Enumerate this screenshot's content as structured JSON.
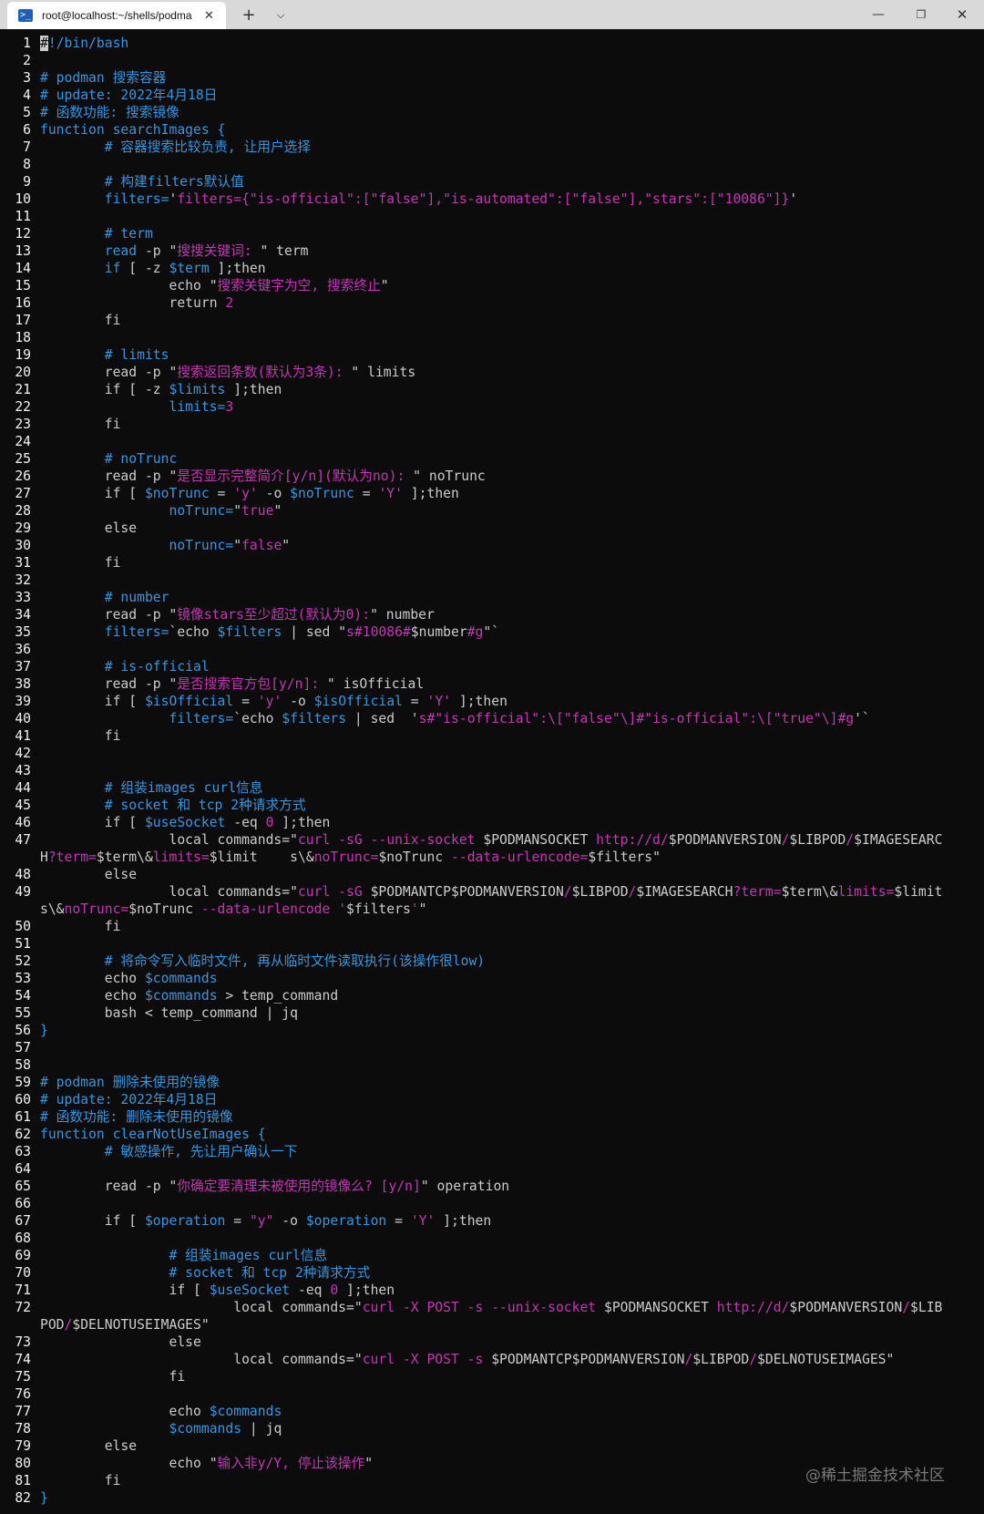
{
  "tab": {
    "title": "root@localhost:~/shells/podma",
    "icon": "powershell-icon"
  },
  "window_controls": {
    "new_tab": "+",
    "dropdown": "⌵",
    "minimize": "—",
    "maximize": "❐",
    "close": "✕"
  },
  "watermark": "@稀土掘金技术社区",
  "colors": {
    "comment": "#3a96dd",
    "string": "#c239b3",
    "text": "#cccccc",
    "background": "#0c0c0c"
  },
  "lines": [
    {
      "n": "1",
      "segs": [
        [
          "cursor",
          "#"
        ],
        [
          "c",
          "!/bin/bash"
        ]
      ]
    },
    {
      "n": "2",
      "segs": []
    },
    {
      "n": "3",
      "segs": [
        [
          "c",
          "# podman 搜索容器"
        ]
      ]
    },
    {
      "n": "4",
      "segs": [
        [
          "c",
          "# update: 2022年4月18日"
        ]
      ]
    },
    {
      "n": "5",
      "segs": [
        [
          "c",
          "# 函数功能: 搜索镜像"
        ]
      ]
    },
    {
      "n": "6",
      "segs": [
        [
          "c",
          "function searchImages {"
        ]
      ]
    },
    {
      "n": "7",
      "segs": [
        [
          "c",
          "        # 容器搜索比较负责, 让用户选择"
        ]
      ]
    },
    {
      "n": "8",
      "segs": []
    },
    {
      "n": "9",
      "segs": [
        [
          "c",
          "        # 构建filters默认值"
        ]
      ]
    },
    {
      "n": "10",
      "segs": [
        [
          "c",
          "        filters="
        ],
        [
          "w",
          "'"
        ],
        [
          "s",
          "filters={\"is-official\":[\"false\"],\"is-automated\":[\"false\"],\"stars\":[\"10086\"]}"
        ],
        [
          "w",
          "'"
        ]
      ]
    },
    {
      "n": "11",
      "segs": []
    },
    {
      "n": "12",
      "segs": [
        [
          "c",
          "        # term"
        ]
      ]
    },
    {
      "n": "13",
      "segs": [
        [
          "c",
          "        read"
        ],
        [
          "w",
          " -p \""
        ],
        [
          "s",
          "搜搜关键词: "
        ],
        [
          "w",
          "\" term"
        ]
      ]
    },
    {
      "n": "14",
      "segs": [
        [
          "c",
          "        if"
        ],
        [
          "w",
          " [ -z "
        ],
        [
          "c",
          "$term"
        ],
        [
          "w",
          " ];then"
        ]
      ]
    },
    {
      "n": "15",
      "segs": [
        [
          "w",
          "                echo \""
        ],
        [
          "s",
          "搜索关键字为空, 搜索终止"
        ],
        [
          "w",
          "\""
        ]
      ]
    },
    {
      "n": "16",
      "segs": [
        [
          "w",
          "                return "
        ],
        [
          "s",
          "2"
        ]
      ]
    },
    {
      "n": "17",
      "segs": [
        [
          "w",
          "        fi"
        ]
      ]
    },
    {
      "n": "18",
      "segs": []
    },
    {
      "n": "19",
      "segs": [
        [
          "c",
          "        # limits"
        ]
      ]
    },
    {
      "n": "20",
      "segs": [
        [
          "w",
          "        read -p \""
        ],
        [
          "s",
          "搜索返回条数(默认为3条): "
        ],
        [
          "w",
          "\" limits"
        ]
      ]
    },
    {
      "n": "21",
      "segs": [
        [
          "w",
          "        if [ -z "
        ],
        [
          "c",
          "$limits"
        ],
        [
          "w",
          " ];then"
        ]
      ]
    },
    {
      "n": "22",
      "segs": [
        [
          "c",
          "                limits="
        ],
        [
          "s",
          "3"
        ]
      ]
    },
    {
      "n": "23",
      "segs": [
        [
          "w",
          "        fi"
        ]
      ]
    },
    {
      "n": "24",
      "segs": []
    },
    {
      "n": "25",
      "segs": [
        [
          "c",
          "        # noTrunc"
        ]
      ]
    },
    {
      "n": "26",
      "segs": [
        [
          "w",
          "        read -p \""
        ],
        [
          "s",
          "是否显示完整简介[y/n](默认为no): "
        ],
        [
          "w",
          "\" noTrunc"
        ]
      ]
    },
    {
      "n": "27",
      "segs": [
        [
          "w",
          "        if [ "
        ],
        [
          "c",
          "$noTrunc"
        ],
        [
          "w",
          " = "
        ],
        [
          "s",
          "'y'"
        ],
        [
          "w",
          " -o "
        ],
        [
          "c",
          "$noTrunc"
        ],
        [
          "w",
          " = "
        ],
        [
          "s",
          "'Y'"
        ],
        [
          "w",
          " ];then"
        ]
      ]
    },
    {
      "n": "28",
      "segs": [
        [
          "c",
          "                noTrunc="
        ],
        [
          "w",
          "\""
        ],
        [
          "s",
          "true"
        ],
        [
          "w",
          "\""
        ]
      ]
    },
    {
      "n": "29",
      "segs": [
        [
          "w",
          "        else"
        ]
      ]
    },
    {
      "n": "30",
      "segs": [
        [
          "c",
          "                noTrunc="
        ],
        [
          "w",
          "\""
        ],
        [
          "s",
          "false"
        ],
        [
          "w",
          "\""
        ]
      ]
    },
    {
      "n": "31",
      "segs": [
        [
          "w",
          "        fi"
        ]
      ]
    },
    {
      "n": "32",
      "segs": []
    },
    {
      "n": "33",
      "segs": [
        [
          "c",
          "        # number"
        ]
      ]
    },
    {
      "n": "34",
      "segs": [
        [
          "w",
          "        read -p \""
        ],
        [
          "s",
          "镜像stars至少超过(默认为0):"
        ],
        [
          "w",
          "\" number"
        ]
      ]
    },
    {
      "n": "35",
      "segs": [
        [
          "c",
          "        filters="
        ],
        [
          "w",
          "`echo "
        ],
        [
          "c",
          "$filters"
        ],
        [
          "w",
          " | sed \""
        ],
        [
          "s",
          "s#10086#"
        ],
        [
          "w",
          "$number"
        ],
        [
          "s",
          "#g"
        ],
        [
          "w",
          "\"`"
        ]
      ]
    },
    {
      "n": "36",
      "segs": []
    },
    {
      "n": "37",
      "segs": [
        [
          "c",
          "        # is-official"
        ]
      ]
    },
    {
      "n": "38",
      "segs": [
        [
          "w",
          "        read -p \""
        ],
        [
          "s",
          "是否搜索官方包[y/n]: "
        ],
        [
          "w",
          "\" isOfficial"
        ]
      ]
    },
    {
      "n": "39",
      "segs": [
        [
          "w",
          "        if [ "
        ],
        [
          "c",
          "$isOfficial"
        ],
        [
          "w",
          " = "
        ],
        [
          "s",
          "'y'"
        ],
        [
          "w",
          " -o "
        ],
        [
          "c",
          "$isOfficial"
        ],
        [
          "w",
          " = "
        ],
        [
          "s",
          "'Y'"
        ],
        [
          "w",
          " ];then"
        ]
      ]
    },
    {
      "n": "40",
      "segs": [
        [
          "c",
          "                filters="
        ],
        [
          "w",
          "`echo "
        ],
        [
          "c",
          "$filters"
        ],
        [
          "w",
          " | sed  '"
        ],
        [
          "s",
          "s#\"is-official\":\\[\"false\"\\]#\"is-official\":\\[\"true\"\\]#g"
        ],
        [
          "w",
          "'`"
        ]
      ]
    },
    {
      "n": "41",
      "segs": [
        [
          "w",
          "        fi"
        ]
      ]
    },
    {
      "n": "42",
      "segs": []
    },
    {
      "n": "43",
      "segs": []
    },
    {
      "n": "44",
      "segs": [
        [
          "c",
          "        # 组装images curl信息"
        ]
      ]
    },
    {
      "n": "45",
      "segs": [
        [
          "c",
          "        # socket 和 tcp 2种请求方式"
        ]
      ]
    },
    {
      "n": "46",
      "segs": [
        [
          "w",
          "        if [ "
        ],
        [
          "c",
          "$useSocket"
        ],
        [
          "w",
          " -eq "
        ],
        [
          "s",
          "0"
        ],
        [
          "w",
          " ];then"
        ]
      ]
    },
    {
      "n": "47",
      "segs": [
        [
          "w",
          "                local commands=\""
        ],
        [
          "s",
          "curl -sG --unix-socket "
        ],
        [
          "w",
          "$PODMANSOCKET "
        ],
        [
          "s",
          "http://d/"
        ],
        [
          "w",
          "$PODMANVERSION"
        ],
        [
          "s",
          "/"
        ],
        [
          "w",
          "$LIBPOD"
        ],
        [
          "s",
          "/"
        ],
        [
          "w",
          "$IMAGESEARC"
        ]
      ]
    },
    {
      "n": "",
      "segs": [
        [
          "w",
          "H"
        ],
        [
          "s",
          "?term="
        ],
        [
          "w",
          "$term\\&"
        ],
        [
          "s",
          "limits="
        ],
        [
          "w",
          "$limit    s\\&"
        ],
        [
          "s",
          "noTrunc="
        ],
        [
          "w",
          "$noTrunc "
        ],
        [
          "s",
          "--data-urlencode="
        ],
        [
          "w",
          "$filters\""
        ]
      ]
    },
    {
      "n": "48",
      "segs": [
        [
          "w",
          "        else"
        ]
      ]
    },
    {
      "n": "49",
      "segs": [
        [
          "w",
          "                local commands=\""
        ],
        [
          "s",
          "curl -sG "
        ],
        [
          "w",
          "$PODMANTCP$PODMANVERSION"
        ],
        [
          "s",
          "/"
        ],
        [
          "w",
          "$LIBPOD"
        ],
        [
          "s",
          "/"
        ],
        [
          "w",
          "$IMAGESEARCH"
        ],
        [
          "s",
          "?term="
        ],
        [
          "w",
          "$term\\&"
        ],
        [
          "s",
          "limits="
        ],
        [
          "w",
          "$limit"
        ]
      ]
    },
    {
      "n": "",
      "segs": [
        [
          "w",
          "s\\&"
        ],
        [
          "s",
          "noTrunc="
        ],
        [
          "w",
          "$noTrunc "
        ],
        [
          "s",
          "--data-urlencode '"
        ],
        [
          "w",
          "$filters"
        ],
        [
          "s",
          "'"
        ],
        [
          "w",
          "\""
        ]
      ]
    },
    {
      "n": "50",
      "segs": [
        [
          "w",
          "        fi"
        ]
      ]
    },
    {
      "n": "51",
      "segs": []
    },
    {
      "n": "52",
      "segs": [
        [
          "c",
          "        # 将命令写入临时文件, 再从临时文件读取执行(该操作很low)"
        ]
      ]
    },
    {
      "n": "53",
      "segs": [
        [
          "w",
          "        echo "
        ],
        [
          "c",
          "$commands"
        ]
      ]
    },
    {
      "n": "54",
      "segs": [
        [
          "w",
          "        echo "
        ],
        [
          "c",
          "$commands"
        ],
        [
          "w",
          " > temp_command"
        ]
      ]
    },
    {
      "n": "55",
      "segs": [
        [
          "w",
          "        bash < temp_command | jq"
        ]
      ]
    },
    {
      "n": "56",
      "segs": [
        [
          "c",
          "}"
        ]
      ]
    },
    {
      "n": "57",
      "segs": []
    },
    {
      "n": "58",
      "segs": []
    },
    {
      "n": "59",
      "segs": [
        [
          "c",
          "# podman 删除未使用的镜像"
        ]
      ]
    },
    {
      "n": "60",
      "segs": [
        [
          "c",
          "# update: 2022年4月18日"
        ]
      ]
    },
    {
      "n": "61",
      "segs": [
        [
          "c",
          "# 函数功能: 删除未使用的镜像"
        ]
      ]
    },
    {
      "n": "62",
      "segs": [
        [
          "c",
          "function clearNotUseImages {"
        ]
      ]
    },
    {
      "n": "63",
      "segs": [
        [
          "c",
          "        # 敏感操作, 先让用户确认一下"
        ]
      ]
    },
    {
      "n": "64",
      "segs": []
    },
    {
      "n": "65",
      "segs": [
        [
          "w",
          "        read -p \""
        ],
        [
          "s",
          "你确定要清理未被使用的镜像么? [y/n]"
        ],
        [
          "w",
          "\" operation"
        ]
      ]
    },
    {
      "n": "66",
      "segs": []
    },
    {
      "n": "67",
      "segs": [
        [
          "w",
          "        if [ "
        ],
        [
          "c",
          "$operation"
        ],
        [
          "w",
          " = "
        ],
        [
          "s",
          "\"y\""
        ],
        [
          "w",
          " -o "
        ],
        [
          "c",
          "$operation"
        ],
        [
          "w",
          " = "
        ],
        [
          "s",
          "'Y'"
        ],
        [
          "w",
          " ];then"
        ]
      ]
    },
    {
      "n": "68",
      "segs": []
    },
    {
      "n": "69",
      "segs": [
        [
          "c",
          "                # 组装images curl信息"
        ]
      ]
    },
    {
      "n": "70",
      "segs": [
        [
          "c",
          "                # socket 和 tcp 2种请求方式"
        ]
      ]
    },
    {
      "n": "71",
      "segs": [
        [
          "w",
          "                if [ "
        ],
        [
          "c",
          "$useSocket"
        ],
        [
          "w",
          " -eq "
        ],
        [
          "s",
          "0"
        ],
        [
          "w",
          " ];then"
        ]
      ]
    },
    {
      "n": "72",
      "segs": [
        [
          "w",
          "                        local commands=\""
        ],
        [
          "s",
          "curl -X POST -s --unix-socket "
        ],
        [
          "w",
          "$PODMANSOCKET "
        ],
        [
          "s",
          "http://d/"
        ],
        [
          "w",
          "$PODMANVERSION"
        ],
        [
          "s",
          "/"
        ],
        [
          "w",
          "$LIB"
        ]
      ]
    },
    {
      "n": "",
      "segs": [
        [
          "w",
          "POD"
        ],
        [
          "s",
          "/"
        ],
        [
          "w",
          "$DELNOTUSEIMAGES\""
        ]
      ]
    },
    {
      "n": "73",
      "segs": [
        [
          "w",
          "                else"
        ]
      ]
    },
    {
      "n": "74",
      "segs": [
        [
          "w",
          "                        local commands=\""
        ],
        [
          "s",
          "curl -X POST -s "
        ],
        [
          "w",
          "$PODMANTCP$PODMANVERSION"
        ],
        [
          "s",
          "/"
        ],
        [
          "w",
          "$LIBPOD"
        ],
        [
          "s",
          "/"
        ],
        [
          "w",
          "$DELNOTUSEIMAGES\""
        ]
      ]
    },
    {
      "n": "75",
      "segs": [
        [
          "w",
          "                fi"
        ]
      ]
    },
    {
      "n": "76",
      "segs": []
    },
    {
      "n": "77",
      "segs": [
        [
          "w",
          "                echo "
        ],
        [
          "c",
          "$commands"
        ]
      ]
    },
    {
      "n": "78",
      "segs": [
        [
          "c",
          "                $commands"
        ],
        [
          "w",
          " | jq"
        ]
      ]
    },
    {
      "n": "79",
      "segs": [
        [
          "w",
          "        else"
        ]
      ]
    },
    {
      "n": "80",
      "segs": [
        [
          "w",
          "                echo \""
        ],
        [
          "s",
          "输入非y/Y, 停止该操作"
        ],
        [
          "w",
          "\""
        ]
      ]
    },
    {
      "n": "81",
      "segs": [
        [
          "w",
          "        fi"
        ]
      ]
    },
    {
      "n": "82",
      "segs": [
        [
          "c",
          "}"
        ]
      ]
    }
  ]
}
